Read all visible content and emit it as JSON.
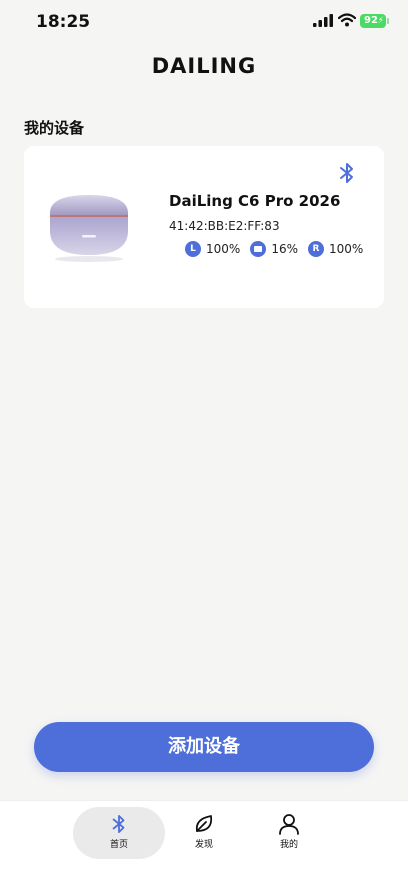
{
  "status_bar": {
    "time": "18:25",
    "battery": "92"
  },
  "brand": {
    "logo_text": "DAILING"
  },
  "section": {
    "title": "我的设备"
  },
  "device": {
    "name": "DaiLing C6 Pro 2026",
    "mac": "41:42:BB:E2:FF:83",
    "battery": [
      {
        "badge": "L",
        "value": "100%"
      },
      {
        "badge": "",
        "value": "16%"
      },
      {
        "badge": "R",
        "value": "100%"
      }
    ]
  },
  "actions": {
    "add_device": "添加设备"
  },
  "tabs": [
    {
      "label": "首页",
      "icon": "bluetooth-icon",
      "active": true
    },
    {
      "label": "发现",
      "icon": "leaf-icon",
      "active": false
    },
    {
      "label": "我的",
      "icon": "user-icon",
      "active": false
    }
  ],
  "colors": {
    "accent": "#4e6fd9",
    "battery_green": "#4cd964",
    "background": "#f5f5f4"
  }
}
